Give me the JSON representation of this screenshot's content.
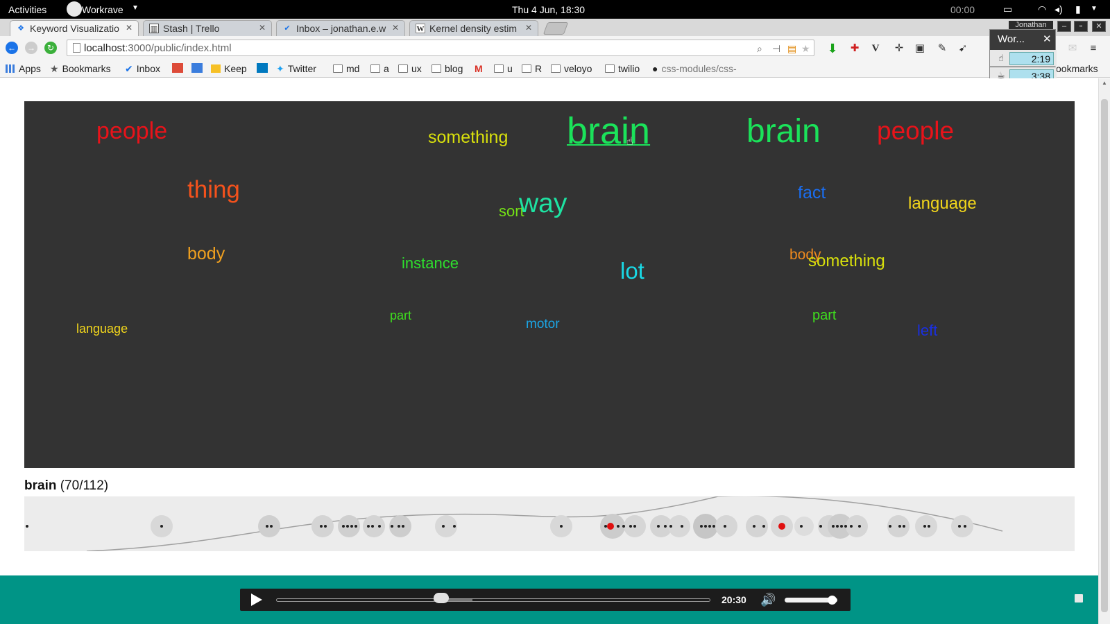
{
  "system_bar": {
    "activities": "Activities",
    "app_menu": "Workrave",
    "clock": "Thu  4 Jun, 18:30",
    "timer": "00:00"
  },
  "tabs": [
    {
      "label": "Keyword Visualizatio",
      "icon": "app-icon",
      "active": true
    },
    {
      "label": "Stash | Trello",
      "icon": "trello-icon",
      "active": false
    },
    {
      "label": "Inbox – jonathan.e.w",
      "icon": "inbox-icon",
      "active": false
    },
    {
      "label": "Kernel density estim",
      "icon": "wikipedia-icon",
      "active": false
    }
  ],
  "omnibox": {
    "host": "localhost",
    "path": ":3000/public/index.html"
  },
  "bookmarks": [
    {
      "label": "Apps",
      "icon": "apps-grid-icon"
    },
    {
      "label": "Bookmarks",
      "icon": "star-icon"
    },
    {
      "label": "Inbox",
      "icon": "inbox-icon"
    },
    {
      "label": "",
      "icon": "google-plus-icon"
    },
    {
      "label": "",
      "icon": "four-icon"
    },
    {
      "label": "Keep",
      "icon": "keep-icon"
    },
    {
      "label": "",
      "icon": "trello-icon"
    },
    {
      "label": "Twitter",
      "icon": "twitter-icon"
    },
    {
      "label": "md",
      "icon": "folder-icon"
    },
    {
      "label": "a",
      "icon": "folder-icon"
    },
    {
      "label": "ux",
      "icon": "folder-icon"
    },
    {
      "label": "blog",
      "icon": "folder-icon"
    },
    {
      "label": "",
      "icon": "gmail-icon"
    },
    {
      "label": "u",
      "icon": "folder-icon"
    },
    {
      "label": "R",
      "icon": "folder-icon"
    },
    {
      "label": "veloyo",
      "icon": "folder-icon"
    },
    {
      "label": "twilio",
      "icon": "folder-icon"
    },
    {
      "label": "css-modules/css-",
      "icon": "github-icon"
    },
    {
      "label": "ookmarks",
      "icon": "none"
    }
  ],
  "workrave_popup": {
    "user": "Jonathan",
    "title": "Wor...",
    "micro_break": "2:19",
    "rest_break": "3:38"
  },
  "word_cloud": [
    {
      "text": "people",
      "color": "#e8131a"
    },
    {
      "text": "something",
      "color": "#d8e00c"
    },
    {
      "text": "brain",
      "color": "#1be25a",
      "active": true
    },
    {
      "text": "brain",
      "color": "#1be25a"
    },
    {
      "text": "people",
      "color": "#e8131a"
    },
    {
      "text": "thing",
      "color": "#f5521c"
    },
    {
      "text": "sort",
      "color": "#74e016"
    },
    {
      "text": "way",
      "color": "#1ee2a2"
    },
    {
      "text": "fact",
      "color": "#1a6ef2"
    },
    {
      "text": "language",
      "color": "#f2d61b"
    },
    {
      "text": "body",
      "color": "#f0a01f"
    },
    {
      "text": "instance",
      "color": "#2ee02e"
    },
    {
      "text": "lot",
      "color": "#19d9e6"
    },
    {
      "text": "body",
      "color": "#f08a1d"
    },
    {
      "text": "something",
      "color": "#d8e00c"
    },
    {
      "text": "part",
      "color": "#3fe01e"
    },
    {
      "text": "motor",
      "color": "#1ba6e6"
    },
    {
      "text": "part",
      "color": "#3fe01e"
    },
    {
      "text": "left",
      "color": "#1a2fe0"
    },
    {
      "text": "language",
      "color": "#f2d61b"
    }
  ],
  "selection": {
    "keyword": "brain",
    "count": "(70/112)"
  },
  "player": {
    "time": "20:30",
    "progress": 0.38,
    "volume": 0.9
  }
}
